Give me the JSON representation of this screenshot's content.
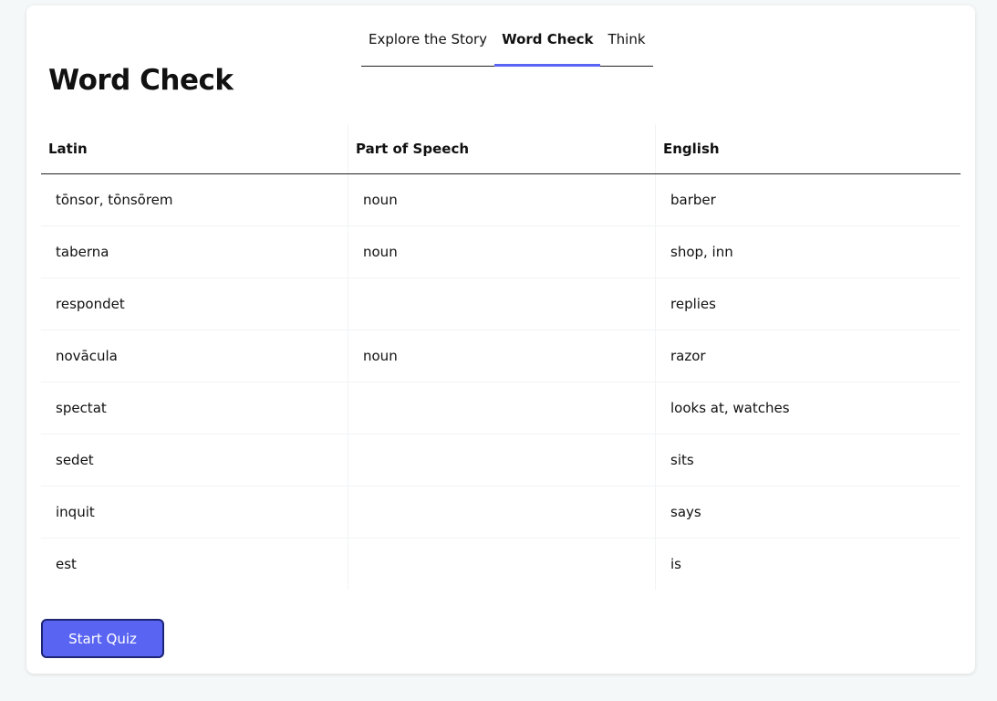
{
  "tabs": [
    {
      "label": "Explore the Story",
      "active": false
    },
    {
      "label": "Word Check",
      "active": true
    },
    {
      "label": "Think",
      "active": false
    }
  ],
  "page_title": "Word Check",
  "table": {
    "headers": [
      "Latin",
      "Part of Speech",
      "English"
    ],
    "rows": [
      [
        "tōnsor, tōnsōrem",
        "noun",
        "barber"
      ],
      [
        "taberna",
        "noun",
        "shop, inn"
      ],
      [
        "respondet",
        "",
        "replies"
      ],
      [
        "novācula",
        "noun",
        "razor"
      ],
      [
        "spectat",
        "",
        "looks at, watches"
      ],
      [
        "sedet",
        "",
        "sits"
      ],
      [
        "inquit",
        "",
        "says"
      ],
      [
        "est",
        "",
        "is"
      ]
    ]
  },
  "quiz_button": "Start Quiz",
  "colors": {
    "accent": "#5964f2",
    "accent_border": "#1d2475",
    "background": "#f5f8f9"
  }
}
